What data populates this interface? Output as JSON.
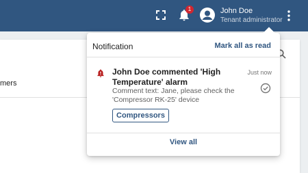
{
  "header": {
    "user_name": "John Doe",
    "user_role": "Tenant administrator",
    "notification_count": "1",
    "icons": [
      "fullscreen-icon",
      "notifications-icon",
      "account-circle-icon",
      "more-vert-icon"
    ],
    "colors": {
      "bar": "#305680",
      "badge": "#d12730"
    }
  },
  "background": {
    "partial_label": "mers"
  },
  "notification_panel": {
    "title": "Notification",
    "mark_all_label": "Mark all as read",
    "view_all_label": "View all",
    "items": [
      {
        "title": "John Doe commented 'High Temperature' alarm",
        "text": "Comment text: Jane, please check the 'Compressor RK-25' device",
        "time": "Just now",
        "button_label": "Compressors",
        "icon": "alarm-bell-icon",
        "icon_color": "#b71c1c"
      }
    ]
  }
}
